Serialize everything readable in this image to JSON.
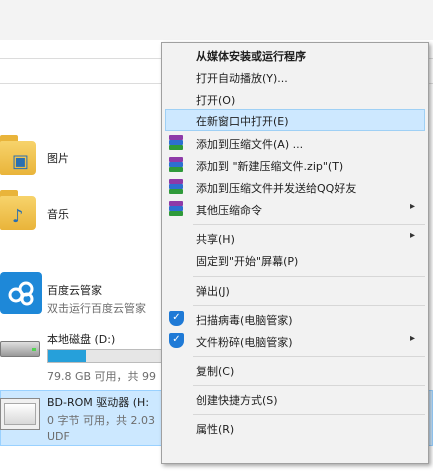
{
  "explorer": {
    "folders": [
      {
        "label": "图片",
        "icon": "pictures-folder-icon"
      },
      {
        "label": "音乐",
        "icon": "music-folder-icon"
      }
    ],
    "baidu": {
      "title": "百度云管家",
      "subtitle": "双击运行百度云管家",
      "icon": "baidu-cloud-icon"
    },
    "local_disk": {
      "title": "本地磁盘 (D:)",
      "space": "79.8 GB 可用，共 99",
      "used_fraction": 0.32
    },
    "bd_rom": {
      "title": "BD-ROM 驱动器 (H:",
      "space": "0 字节 可用，共 2.03",
      "fs": "UDF"
    }
  },
  "context_menu": {
    "items": [
      {
        "label": "从媒体安装或运行程序",
        "bold": true
      },
      {
        "label": "打开自动播放(Y)..."
      },
      {
        "label": "打开(O)"
      },
      {
        "label": "在新窗口中打开(E)",
        "highlighted": true
      },
      {
        "label": "添加到压缩文件(A) ...",
        "icon": "winrar-icon"
      },
      {
        "label": "添加到 \"新建压缩文件.zip\"(T)",
        "icon": "winrar-icon"
      },
      {
        "label": "添加到压缩文件并发送给QQ好友",
        "icon": "winrar-icon"
      },
      {
        "label": "其他压缩命令",
        "icon": "winrar-icon",
        "submenu": true
      },
      {
        "label": "共享(H)",
        "submenu": true
      },
      {
        "label": "固定到\"开始\"屏幕(P)"
      },
      {
        "label": "弹出(J)"
      },
      {
        "label": "扫描病毒(电脑管家)",
        "icon": "tencent-shield-icon"
      },
      {
        "label": "文件粉碎(电脑管家)",
        "icon": "tencent-shield-icon",
        "submenu": true
      },
      {
        "label": "复制(C)"
      },
      {
        "label": "创建快捷方式(S)"
      },
      {
        "label": "属性(R)"
      }
    ],
    "submenu_arrow": "▸"
  },
  "colors": {
    "menu_bg": "#f2f2f2",
    "highlight": "#cde8ff",
    "selection": "#cce8ff",
    "progress": "#26a0da"
  }
}
